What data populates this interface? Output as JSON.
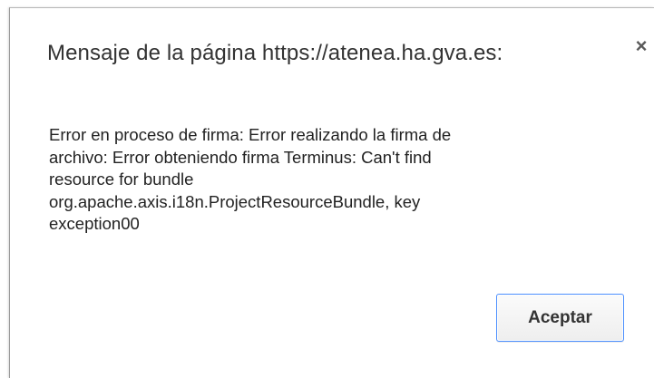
{
  "dialog": {
    "title": "Mensaje de la página https://atenea.ha.gva.es:",
    "close_symbol": "×",
    "message_lines": [
      "Error en proceso de firma: Error realizando la firma de",
      "archivo: Error obteniendo firma Terminus: Can't find",
      "resource for bundle",
      "org.apache.axis.i18n.ProjectResourceBundle, key",
      "exception00"
    ],
    "ok_label": "Aceptar"
  },
  "colors": {
    "button_focus_border": "#4d90fe",
    "title_text": "#333333",
    "message_text": "#222222"
  }
}
